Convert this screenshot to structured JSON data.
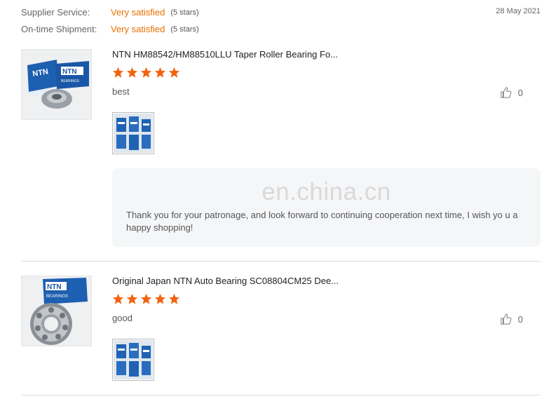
{
  "ratings": {
    "supplier_service": {
      "label": "Supplier Service:",
      "value": "Very satisfied",
      "stars": "(5 stars)"
    },
    "ontime_shipment": {
      "label": "On-time Shipment:",
      "value": "Very satisfied",
      "stars": "(5 stars)"
    },
    "date": "28 May 2021"
  },
  "reviews": [
    {
      "title": "NTN HM88542/HM88510LLU Taper Roller Bearing Fo...",
      "rating": 5,
      "comment": "best",
      "likes": "0",
      "reply": {
        "watermark": "en.china.cn",
        "text": "Thank you for your patronage, and look forward to continuing cooperation next time, I wish yo u a happy shopping!"
      }
    },
    {
      "title": "Original Japan NTN Auto Bearing SC08804CM25 Dee...",
      "rating": 5,
      "comment": "good",
      "likes": "0"
    }
  ],
  "colors": {
    "star": "#f2630f",
    "accent": "#e87000"
  },
  "icons": {
    "like": "thumbs-up-icon",
    "star": "star-icon"
  }
}
